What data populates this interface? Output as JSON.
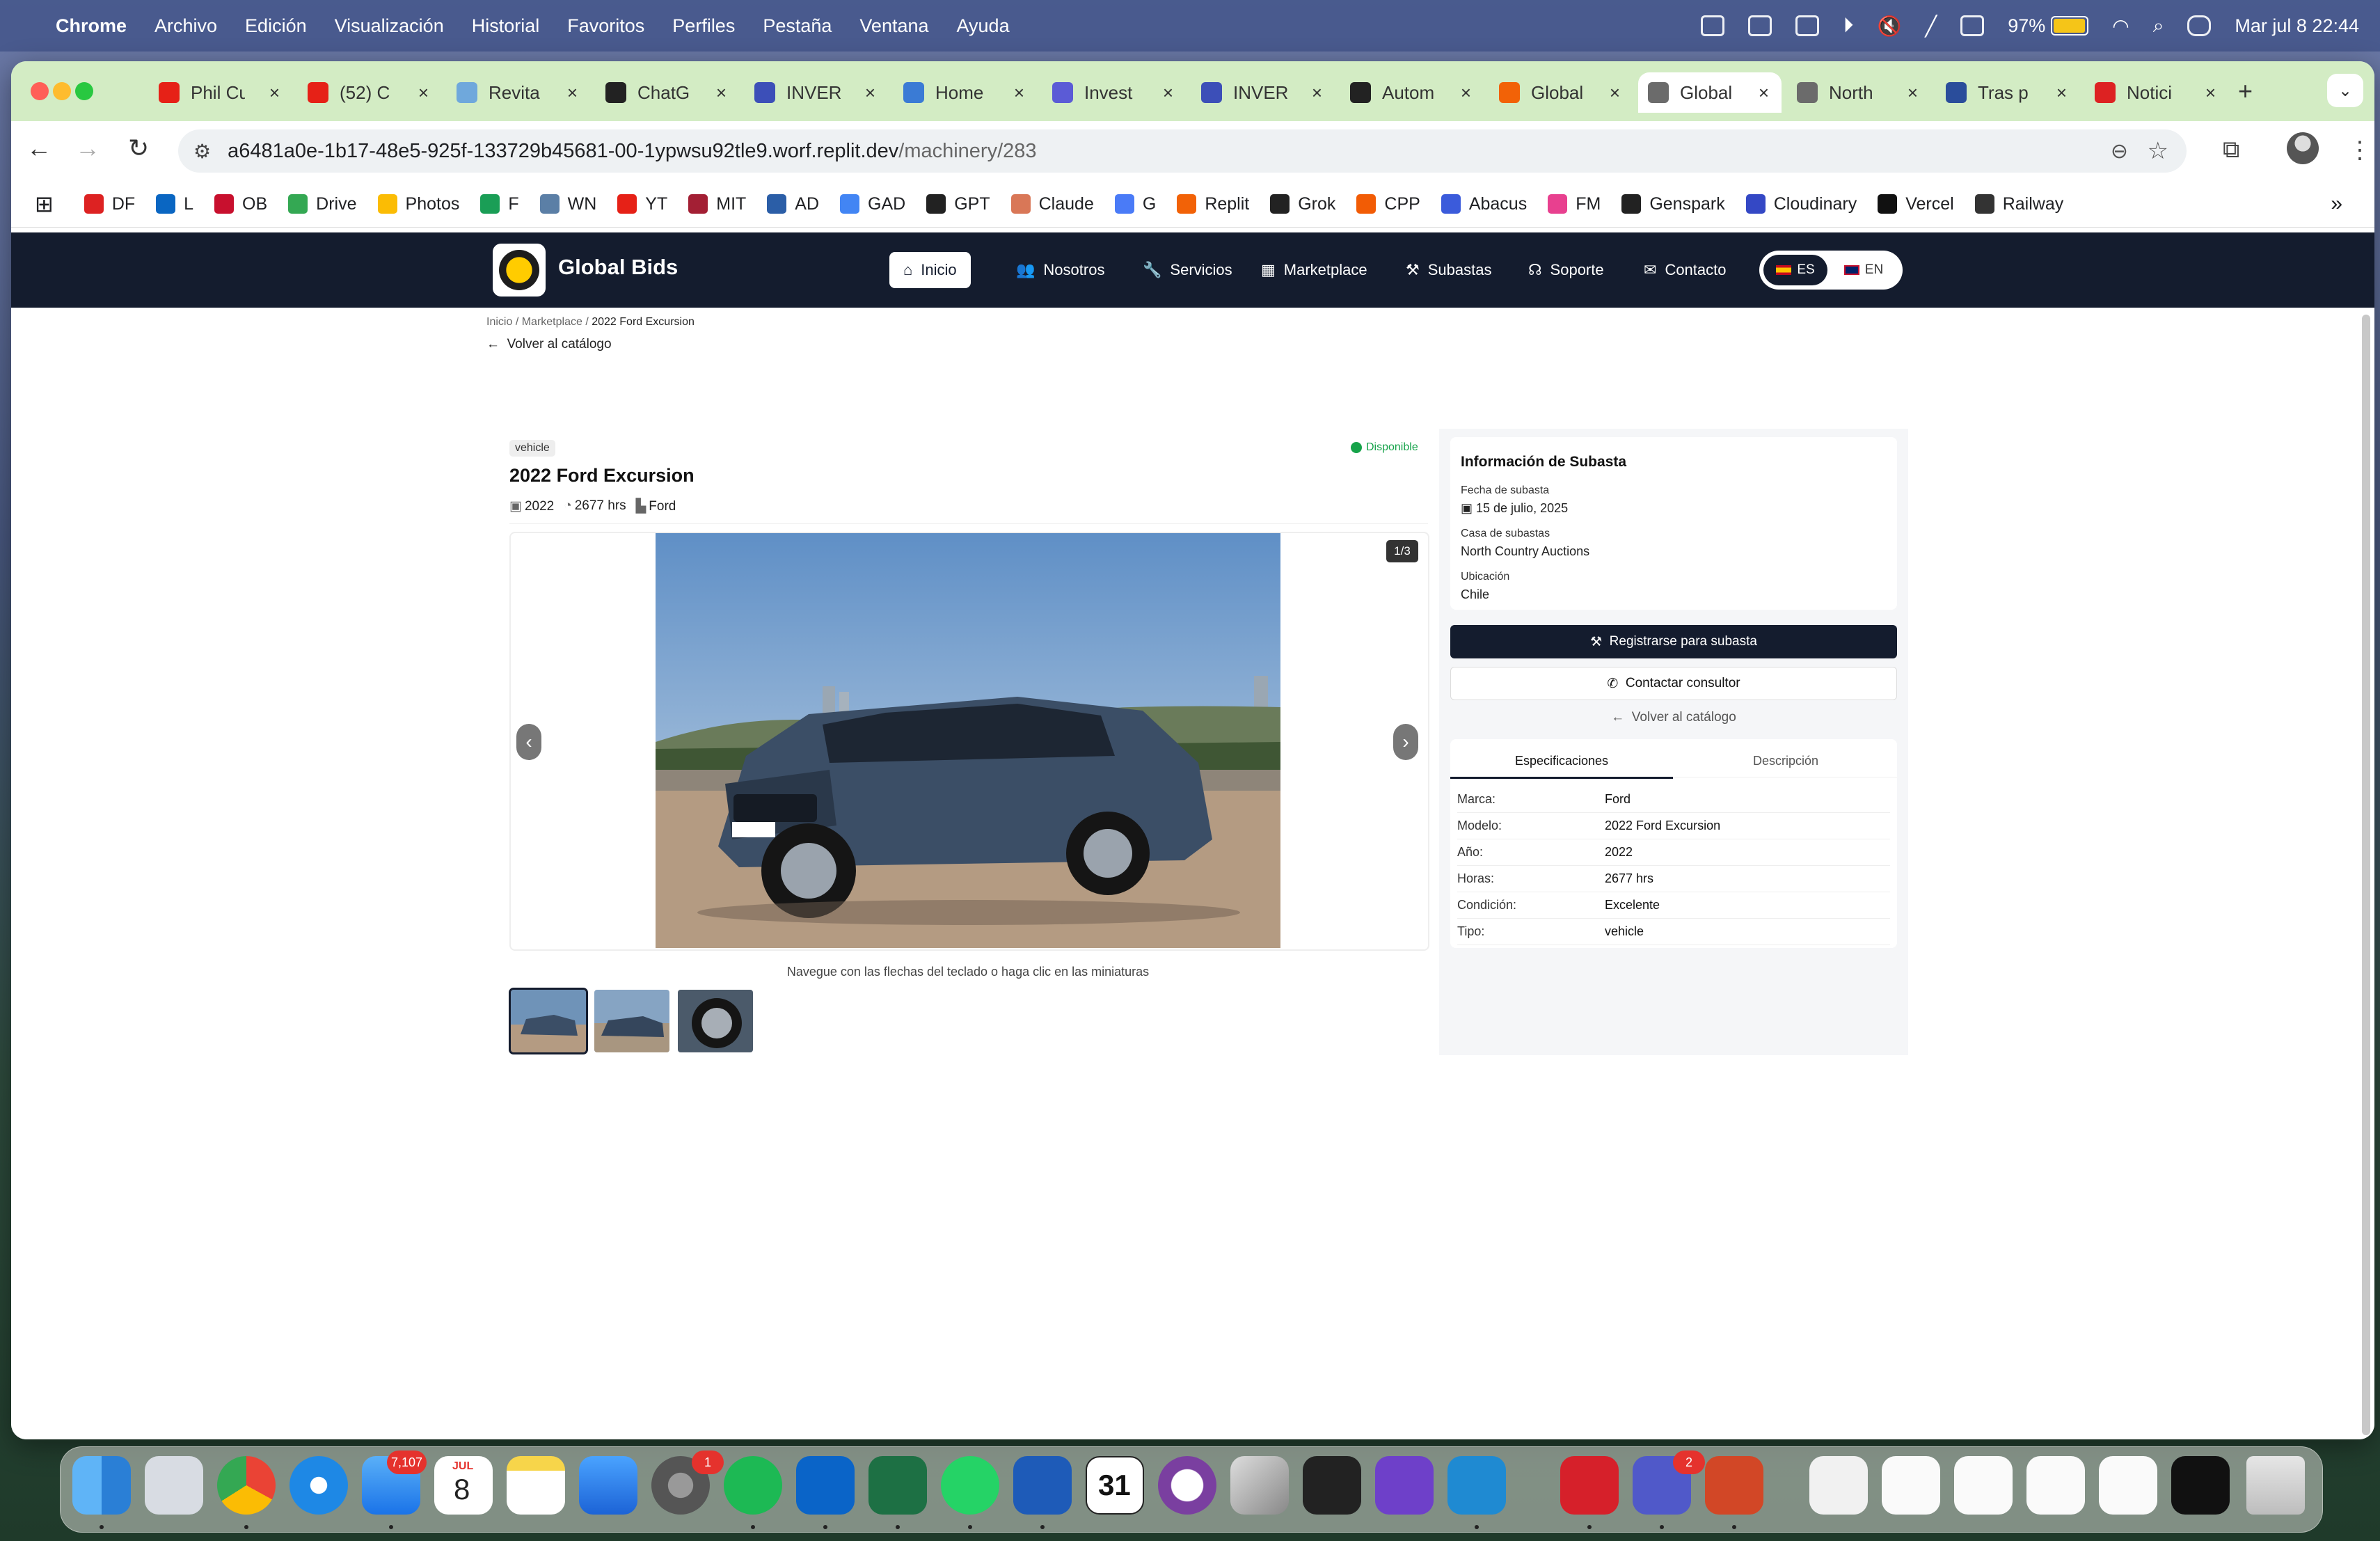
{
  "menubar": {
    "app": "Chrome",
    "items": [
      "Archivo",
      "Edición",
      "Visualización",
      "Historial",
      "Favoritos",
      "Perfiles",
      "Pestaña",
      "Ventana",
      "Ayuda"
    ],
    "battery": "97%",
    "battery_level": 0.97,
    "datetime": "Mar jul 8  22:44"
  },
  "tabs": [
    {
      "title": "Phil Cu",
      "icon": "youtube-icon",
      "color": "#e62117"
    },
    {
      "title": "(52) C",
      "icon": "youtube-icon",
      "color": "#e62117"
    },
    {
      "title": "Revita",
      "icon": "revita-icon",
      "color": "#6fa8dc"
    },
    {
      "title": "ChatG",
      "icon": "openai-icon",
      "color": "#222222"
    },
    {
      "title": "INVER",
      "icon": "inver-icon",
      "color": "#3c4fb8"
    },
    {
      "title": "Home",
      "icon": "home-c-icon",
      "color": "#3a7bd5"
    },
    {
      "title": "Invest",
      "icon": "invest-icon",
      "color": "#5b5bd6"
    },
    {
      "title": "INVER",
      "icon": "inver-icon",
      "color": "#3c4fb8"
    },
    {
      "title": "Autom",
      "icon": "openai-icon",
      "color": "#222222"
    },
    {
      "title": "Global",
      "icon": "replit-icon",
      "color": "#f26207"
    },
    {
      "title": "Global",
      "icon": "globe-icon",
      "color": "#6b6b6b"
    },
    {
      "title": "North",
      "icon": "globe-icon",
      "color": "#6b6b6b"
    },
    {
      "title": "Tras p",
      "icon": "tras-icon",
      "color": "#2a4d9b"
    },
    {
      "title": "Notici",
      "icon": "df-icon",
      "color": "#d22"
    }
  ],
  "address": {
    "host": "a6481a0e-1b17-48e5-925f-133729b45681-00-1ypwsu92tle9.worf.replit.dev",
    "path": "/machinery/283"
  },
  "bookmarks": [
    {
      "label": "DF",
      "color": "#d22"
    },
    {
      "label": "L",
      "color": "#0a66c2"
    },
    {
      "label": "OB",
      "color": "#c8102e"
    },
    {
      "label": "Drive",
      "color": "#34a853"
    },
    {
      "label": "Photos",
      "color": "#fbbc04"
    },
    {
      "label": "F",
      "color": "#1a9e56"
    },
    {
      "label": "WN",
      "color": "#5b7fa6"
    },
    {
      "label": "YT",
      "color": "#e62117"
    },
    {
      "label": "MIT",
      "color": "#a31f34"
    },
    {
      "label": "AD",
      "color": "#2b5ea7"
    },
    {
      "label": "GAD",
      "color": "#4285f4"
    },
    {
      "label": "GPT",
      "color": "#222"
    },
    {
      "label": "Claude",
      "color": "#d97757"
    },
    {
      "label": "G",
      "color": "#4a7bf7"
    },
    {
      "label": "Replit",
      "color": "#f26207"
    },
    {
      "label": "Grok",
      "color": "#222"
    },
    {
      "label": "CPP",
      "color": "#f25c05"
    },
    {
      "label": "Abacus",
      "color": "#3b5bdb"
    },
    {
      "label": "FM",
      "color": "#e8408f"
    },
    {
      "label": "Genspark",
      "color": "#222"
    },
    {
      "label": "Cloudinary",
      "color": "#3448c5"
    },
    {
      "label": "Vercel",
      "color": "#111"
    },
    {
      "label": "Railway",
      "color": "#333"
    }
  ],
  "site": {
    "brand": "Global Bids",
    "nav": [
      {
        "label": "Inicio",
        "icon": "home-icon"
      },
      {
        "label": "Nosotros",
        "icon": "users-icon"
      },
      {
        "label": "Servicios",
        "icon": "wrench-icon"
      },
      {
        "label": "Marketplace",
        "icon": "grid-icon"
      },
      {
        "label": "Subastas",
        "icon": "gavel-icon"
      },
      {
        "label": "Soporte",
        "icon": "headset-icon"
      },
      {
        "label": "Contacto",
        "icon": "envelope-icon"
      }
    ],
    "lang_es": "ES",
    "lang_en": "EN"
  },
  "breadcrumb": {
    "home": "Inicio",
    "sep": "/",
    "marketplace": "Marketplace",
    "current": "2022 Ford Excursion"
  },
  "back_label": "Volver al catálogo",
  "item": {
    "tag": "vehicle",
    "status": "Disponible",
    "title": "2022 Ford Excursion",
    "year": "2022",
    "hours": "2677 hrs",
    "brand": "Ford"
  },
  "gallery": {
    "counter": "1/3",
    "hint": "Navegue con las flechas del teclado o haga clic en las miniaturas"
  },
  "auction": {
    "heading": "Información de Subasta",
    "date_label": "Fecha de subasta",
    "date_value": "15 de julio, 2025",
    "house_label": "Casa de subastas",
    "house_value": "North Country Auctions",
    "location_label": "Ubicación",
    "location_value": "Chile"
  },
  "actions": {
    "register": "Registrarse para subasta",
    "contact": "Contactar consultor",
    "back": "Volver al catálogo"
  },
  "detail_tabs": {
    "specs": "Especificaciones",
    "desc": "Descripción"
  },
  "specs": [
    {
      "k": "Marca:",
      "v": "Ford"
    },
    {
      "k": "Modelo:",
      "v": "2022 Ford Excursion"
    },
    {
      "k": "Año:",
      "v": "2022"
    },
    {
      "k": "Horas:",
      "v": "2677 hrs"
    },
    {
      "k": "Condición:",
      "v": "Excelente"
    },
    {
      "k": "Tipo:",
      "v": "vehicle"
    }
  ],
  "dock": {
    "mail_badge": "7,107",
    "calendar_month": "JUL",
    "calendar_day": "8",
    "settings_badge": "1",
    "teams_badge": "2",
    "fantastical_day": "31"
  }
}
